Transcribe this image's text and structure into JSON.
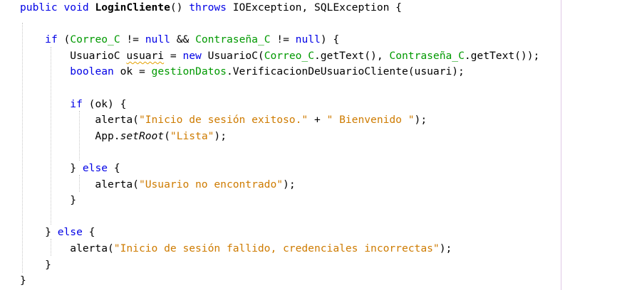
{
  "editor": {
    "margin_color": "#e0c8e6",
    "colors": {
      "keyword": "#0000e6",
      "field": "#009900",
      "string": "#ce7b00",
      "text": "#000000"
    },
    "lines": [
      {
        "tokens": [
          {
            "t": "public void ",
            "c": "kw"
          },
          {
            "t": "LoginCliente",
            "c": "fn"
          },
          {
            "t": "() ",
            "c": ""
          },
          {
            "t": "throws",
            "c": "kw"
          },
          {
            "t": " IOException, SQLException {",
            "c": ""
          }
        ]
      },
      {
        "tokens": []
      },
      {
        "tokens": [
          {
            "t": "    ",
            "c": ""
          },
          {
            "t": "if",
            "c": "kw"
          },
          {
            "t": " (",
            "c": ""
          },
          {
            "t": "Correo_C",
            "c": "fld"
          },
          {
            "t": " != ",
            "c": ""
          },
          {
            "t": "null",
            "c": "kw"
          },
          {
            "t": " && ",
            "c": ""
          },
          {
            "t": "Contraseña_C",
            "c": "fld"
          },
          {
            "t": " != ",
            "c": ""
          },
          {
            "t": "null",
            "c": "kw"
          },
          {
            "t": ") {",
            "c": ""
          }
        ]
      },
      {
        "tokens": [
          {
            "t": "        UsuarioC ",
            "c": ""
          },
          {
            "t": "usuari",
            "c": "sq"
          },
          {
            "t": " = ",
            "c": ""
          },
          {
            "t": "new",
            "c": "kw"
          },
          {
            "t": " UsuarioC(",
            "c": ""
          },
          {
            "t": "Correo_C",
            "c": "fld"
          },
          {
            "t": ".getText(), ",
            "c": ""
          },
          {
            "t": "Contraseña_C",
            "c": "fld"
          },
          {
            "t": ".getText());",
            "c": ""
          }
        ]
      },
      {
        "tokens": [
          {
            "t": "        ",
            "c": ""
          },
          {
            "t": "boolean",
            "c": "kw"
          },
          {
            "t": " ok = ",
            "c": ""
          },
          {
            "t": "gestionDatos",
            "c": "fld"
          },
          {
            "t": ".VerificacionDeUsuarioCliente(usuari);",
            "c": ""
          }
        ]
      },
      {
        "tokens": []
      },
      {
        "tokens": [
          {
            "t": "        ",
            "c": ""
          },
          {
            "t": "if",
            "c": "kw"
          },
          {
            "t": " (ok) {",
            "c": ""
          }
        ]
      },
      {
        "tokens": [
          {
            "t": "            alerta(",
            "c": ""
          },
          {
            "t": "\"Inicio de sesión exitoso.\"",
            "c": "str"
          },
          {
            "t": " + ",
            "c": ""
          },
          {
            "t": "\" Bienvenido \"",
            "c": "str"
          },
          {
            "t": ");",
            "c": ""
          }
        ]
      },
      {
        "tokens": [
          {
            "t": "            App.",
            "c": ""
          },
          {
            "t": "setRoot",
            "c": "it"
          },
          {
            "t": "(",
            "c": ""
          },
          {
            "t": "\"Lista\"",
            "c": "str"
          },
          {
            "t": ");",
            "c": ""
          }
        ]
      },
      {
        "tokens": []
      },
      {
        "tokens": [
          {
            "t": "        } ",
            "c": ""
          },
          {
            "t": "else",
            "c": "kw"
          },
          {
            "t": " {",
            "c": ""
          }
        ]
      },
      {
        "tokens": [
          {
            "t": "            alerta(",
            "c": ""
          },
          {
            "t": "\"Usuario no encontrado\"",
            "c": "str"
          },
          {
            "t": ");",
            "c": ""
          }
        ]
      },
      {
        "tokens": [
          {
            "t": "        }",
            "c": ""
          }
        ]
      },
      {
        "tokens": []
      },
      {
        "tokens": [
          {
            "t": "    } ",
            "c": ""
          },
          {
            "t": "else",
            "c": "kw"
          },
          {
            "t": " {",
            "c": ""
          }
        ]
      },
      {
        "tokens": [
          {
            "t": "        alerta(",
            "c": ""
          },
          {
            "t": "\"Inicio de sesión fallido, credenciales incorrectas\"",
            "c": "str"
          },
          {
            "t": ");",
            "c": ""
          }
        ]
      },
      {
        "tokens": [
          {
            "t": "    }",
            "c": ""
          }
        ]
      },
      {
        "tokens": [
          {
            "t": "}",
            "c": ""
          }
        ]
      }
    ]
  }
}
